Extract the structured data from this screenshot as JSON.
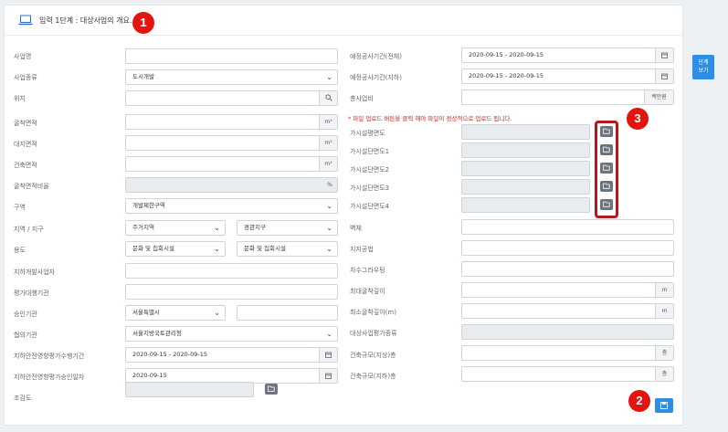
{
  "header": {
    "title": "입력 1단계 : 대상사업의 개요.",
    "icon": "laptop-icon"
  },
  "badges": {
    "one": "1",
    "two": "2",
    "three": "3"
  },
  "side_button": {
    "line1": "단계",
    "line2": "보기"
  },
  "notice": "* 파일 업로드 버튼을 클릭 해야 파일이 정상적으로 업로드 됩니다.",
  "left": {
    "biz_name": {
      "label": "사업명",
      "value": ""
    },
    "biz_type": {
      "label": "사업종류",
      "value": "도시개발"
    },
    "location": {
      "label": "위치",
      "value": ""
    },
    "dig_area": {
      "label": "굴착면적",
      "value": "",
      "unit": "m²"
    },
    "land_area": {
      "label": "대지면적",
      "value": "",
      "unit": "m²"
    },
    "build_area": {
      "label": "건축면적",
      "value": "",
      "unit": "m²"
    },
    "dig_ratio": {
      "label": "굴착면적비율",
      "value": "",
      "unit": "%"
    },
    "zone": {
      "label": "구역",
      "value": "개발제한구역"
    },
    "district": {
      "label": "지역 / 지구",
      "value1": "주거지역",
      "value2": "경관지구"
    },
    "usage": {
      "label": "용도",
      "value1": "문화 및 집회시설",
      "value2": "문화 및 집회시설"
    },
    "developer": {
      "label": "지하개발사업자",
      "value": ""
    },
    "evaluator": {
      "label": "평가대행기관",
      "value": ""
    },
    "approver": {
      "label": "승인기관",
      "value1": "서울특별시",
      "value2": ""
    },
    "consult": {
      "label": "협의기관",
      "value": "서울지방국토관리청"
    },
    "eval_period": {
      "label": "지하안전영향평가수행기간",
      "value": "2020-09-15 - 2020-09-15"
    },
    "approve_date": {
      "label": "지하안전영향평가승인일자",
      "value": "2020-09-15"
    },
    "survey": {
      "label": "조감도",
      "value": ""
    }
  },
  "right": {
    "period_total": {
      "label": "예정공사기간(전체)",
      "value": "2020-09-15 - 2020-09-15"
    },
    "period_under": {
      "label": "예정공사기간(지하)",
      "value": "2020-09-15 - 2020-09-15"
    },
    "total_cost": {
      "label": "총사업비",
      "value": "",
      "unit": "백만원"
    },
    "plan": {
      "label": "가시설평면도"
    },
    "sec1": {
      "label": "가시설단면도1"
    },
    "sec2": {
      "label": "가시설단면도2"
    },
    "sec3": {
      "label": "가시설단면도3"
    },
    "sec4": {
      "label": "가시설단면도4"
    },
    "wall": {
      "label": "벽체",
      "value": ""
    },
    "support": {
      "label": "지지공법",
      "value": ""
    },
    "grout": {
      "label": "차수그라우팅",
      "value": ""
    },
    "max_depth": {
      "label": "최대굴착깊이",
      "value": "",
      "unit": "m"
    },
    "min_depth": {
      "label": "최소굴착깊이(m)",
      "value": "",
      "unit": "m"
    },
    "target_type": {
      "label": "대상사업평가종류",
      "value": ""
    },
    "floors_up": {
      "label": "건축규모(지상)층",
      "value": "",
      "unit": "층"
    },
    "floors_down": {
      "label": "건축규모(지하)층",
      "value": "",
      "unit": "층"
    }
  }
}
